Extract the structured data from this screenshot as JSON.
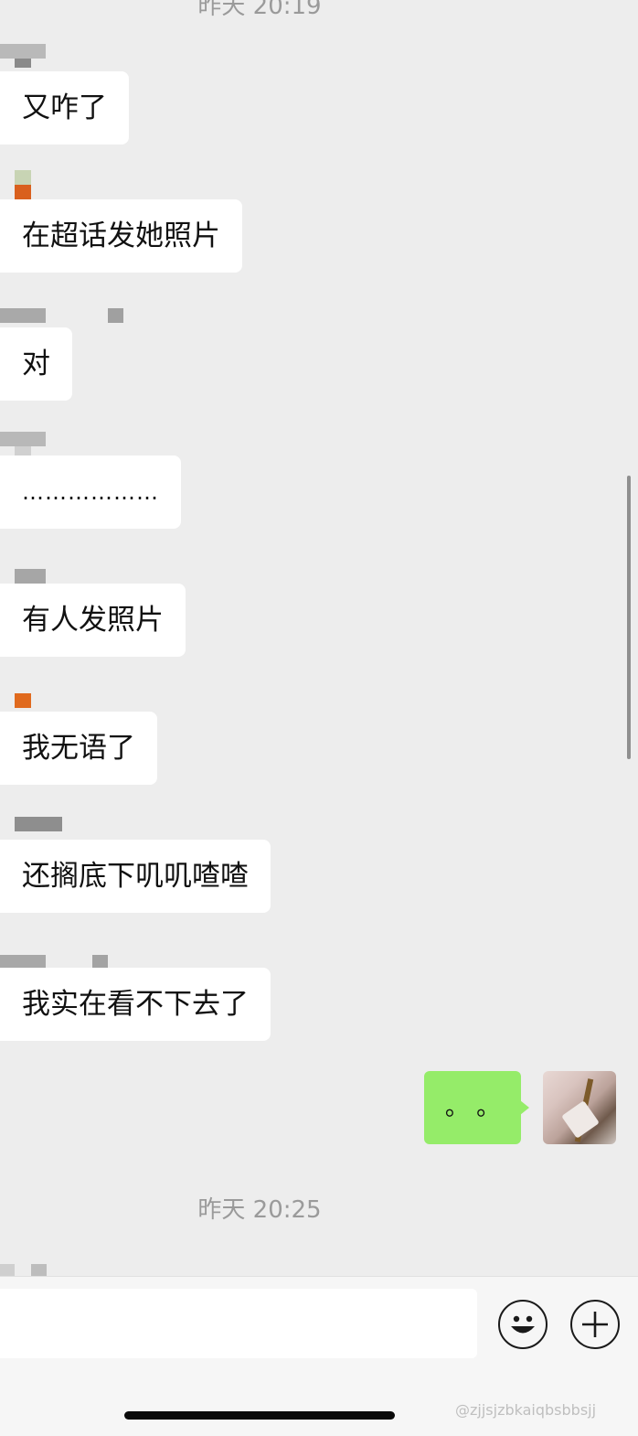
{
  "timestamps": [
    "昨天 20:19",
    "昨天 20:25"
  ],
  "messages": [
    {
      "text": "又咋了"
    },
    {
      "text": "在超话发她照片"
    },
    {
      "text": "对"
    },
    {
      "text": "………………"
    },
    {
      "text": "有人发照片"
    },
    {
      "text": "我无语了"
    },
    {
      "text": "还搁底下叽叽喳喳"
    },
    {
      "text": "我实在看不下去了"
    }
  ],
  "my_message": {
    "text": "。 。"
  },
  "input": {
    "placeholder": "",
    "emoji_icon": "smiley-face-icon",
    "plus_icon": "plus-icon"
  },
  "watermark": "@zjjsjzbkaiqbsbbsjj",
  "colors": {
    "background": "#ededed",
    "bubble_other": "#ffffff",
    "bubble_self": "#95ec69"
  }
}
